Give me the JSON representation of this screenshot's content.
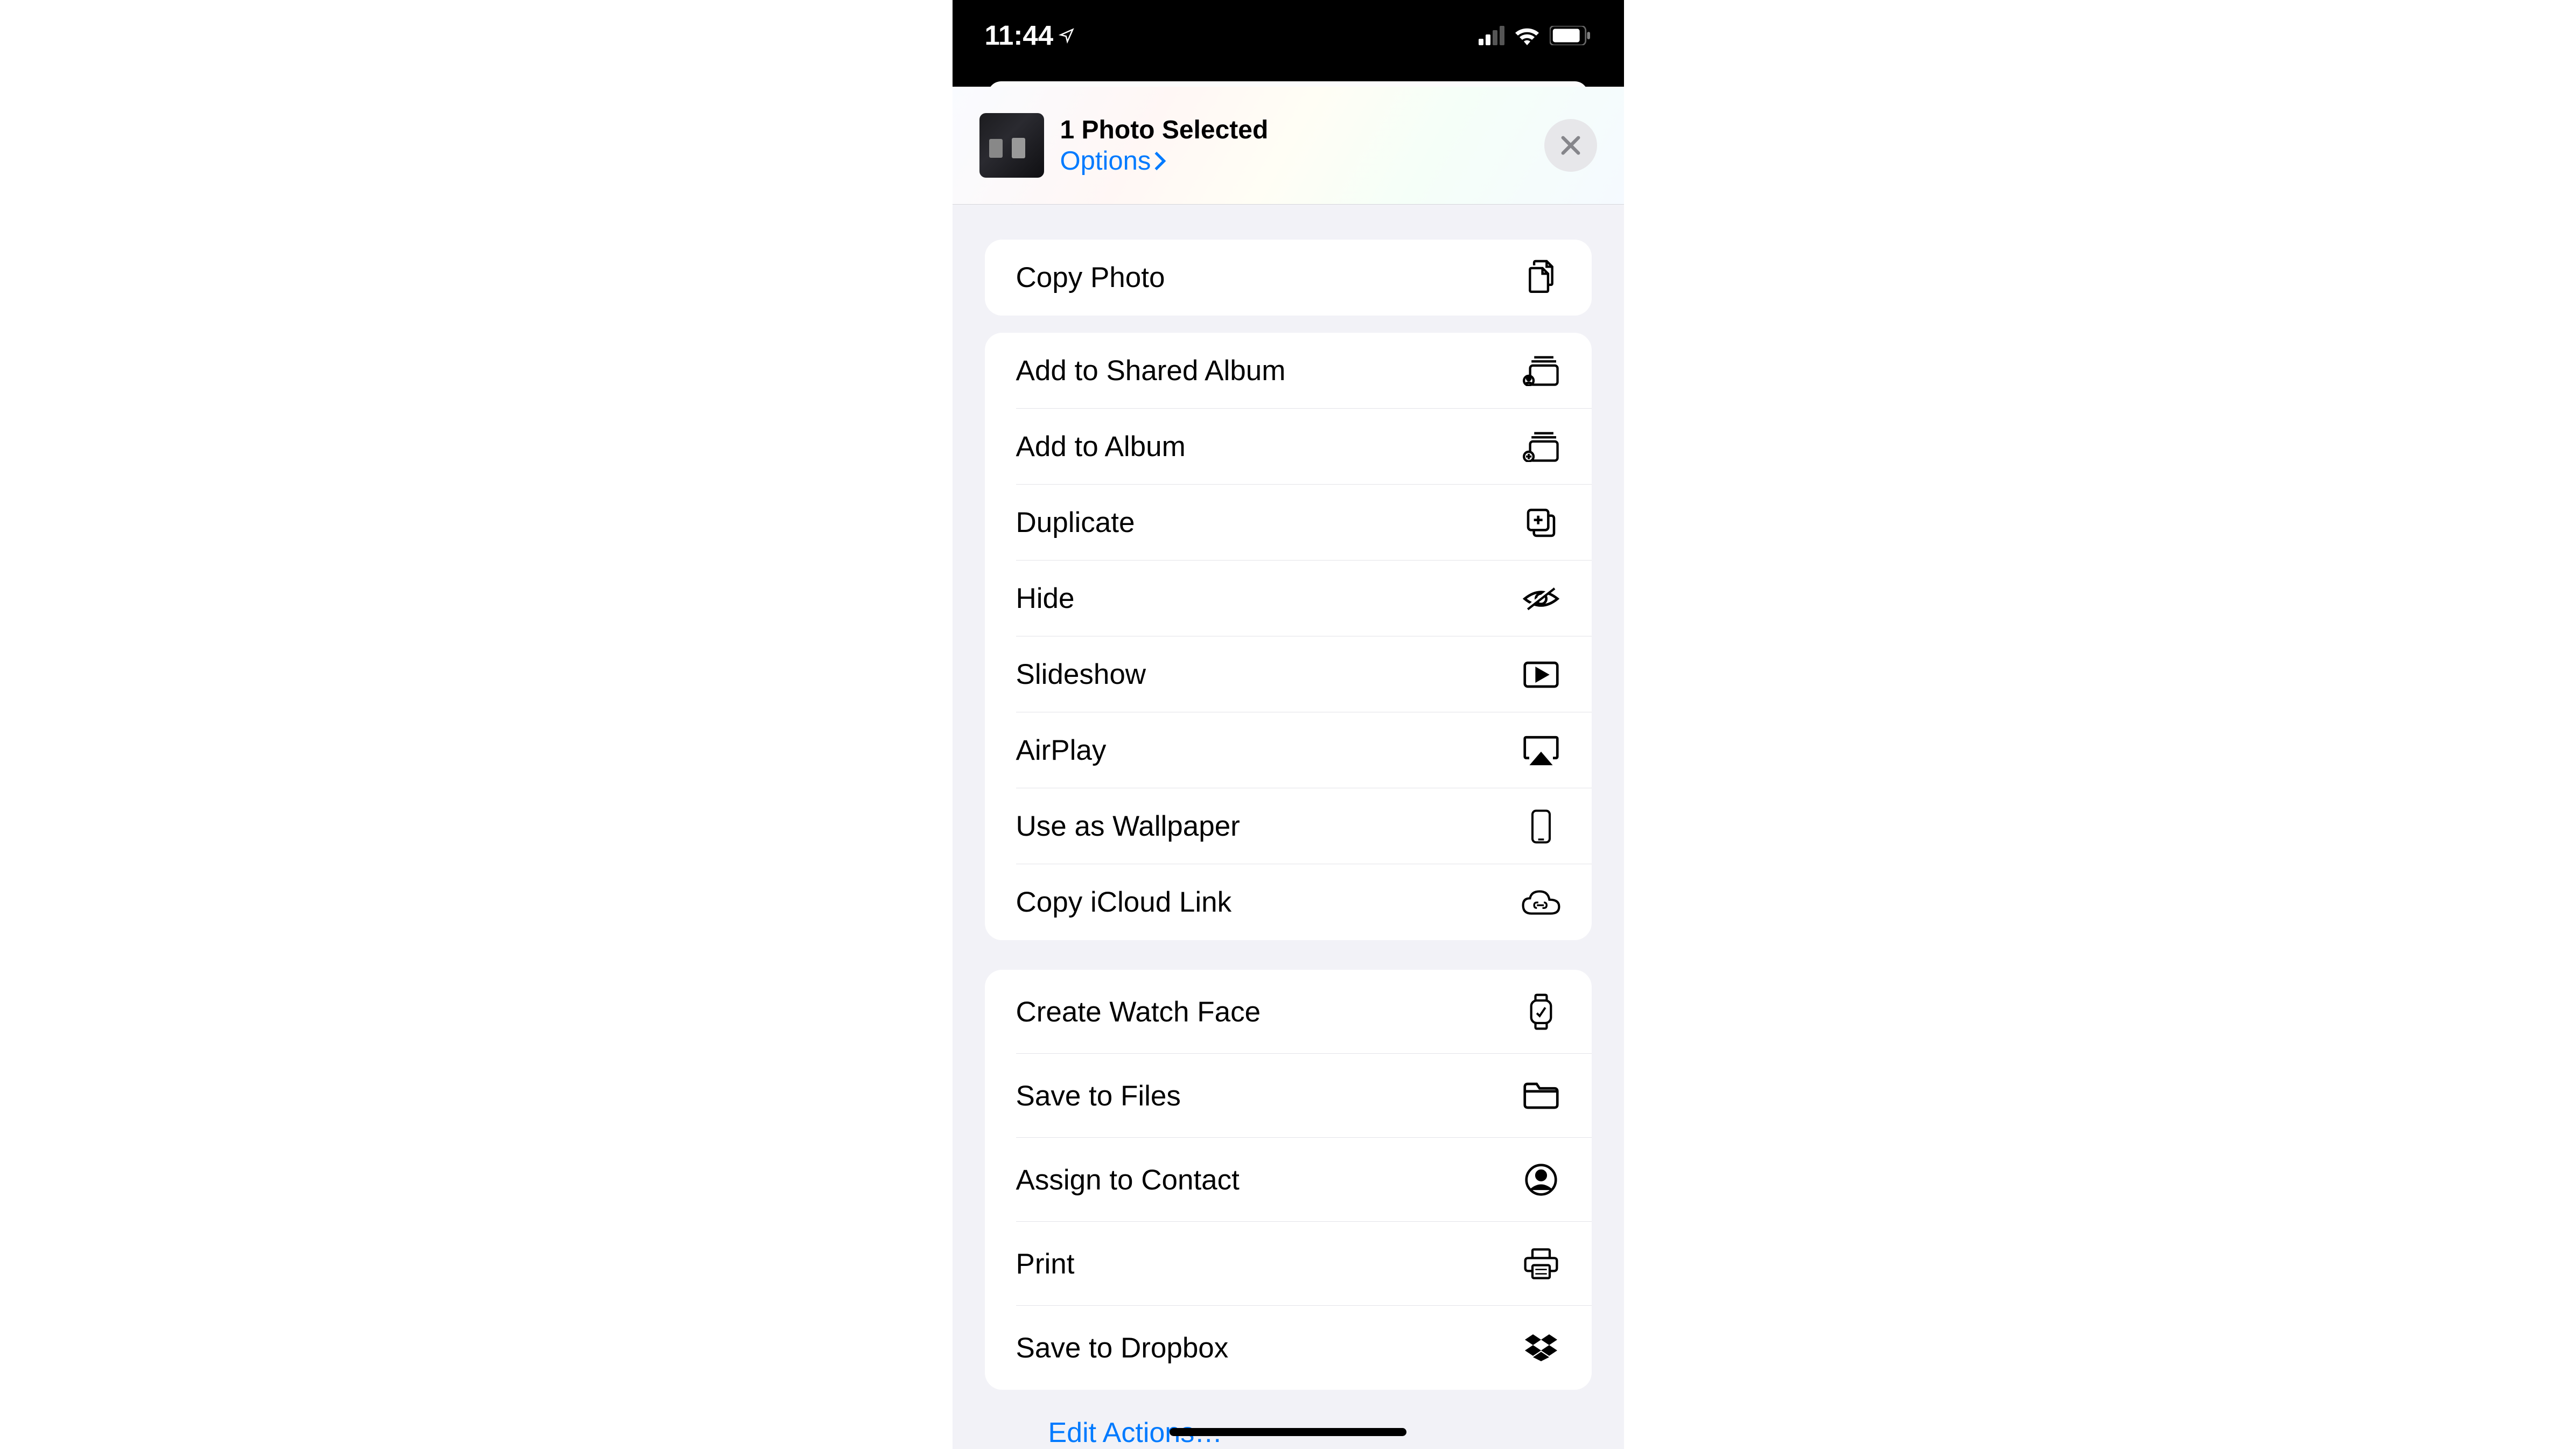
{
  "status": {
    "time": "11:44"
  },
  "header": {
    "title": "1 Photo Selected",
    "options": "Options"
  },
  "groups": [
    {
      "actions": [
        {
          "label": "Copy Photo",
          "icon": "copy-docs"
        }
      ]
    },
    {
      "actions": [
        {
          "label": "Add to Shared Album",
          "icon": "shared-album"
        },
        {
          "label": "Add to Album",
          "icon": "add-album"
        },
        {
          "label": "Duplicate",
          "icon": "duplicate"
        },
        {
          "label": "Hide",
          "icon": "hide"
        },
        {
          "label": "Slideshow",
          "icon": "slideshow"
        },
        {
          "label": "AirPlay",
          "icon": "airplay"
        },
        {
          "label": "Use as Wallpaper",
          "icon": "wallpaper"
        },
        {
          "label": "Copy iCloud Link",
          "icon": "icloud-link"
        }
      ]
    },
    {
      "actions": [
        {
          "label": "Create Watch Face",
          "icon": "watch"
        },
        {
          "label": "Save to Files",
          "icon": "folder"
        },
        {
          "label": "Assign to Contact",
          "icon": "contact"
        },
        {
          "label": "Print",
          "icon": "print"
        },
        {
          "label": "Save to Dropbox",
          "icon": "dropbox"
        }
      ]
    }
  ],
  "footer": {
    "edit": "Edit Actions…"
  }
}
